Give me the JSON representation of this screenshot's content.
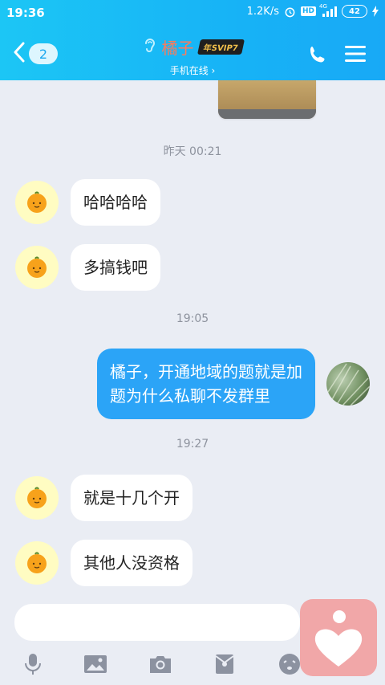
{
  "status_bar": {
    "time": "19:36",
    "network_speed": "1.2K/s",
    "hd_label": "HD",
    "signal_label": "4G",
    "battery": "42"
  },
  "header": {
    "back_badge": "2",
    "contact_name": "橘子",
    "vip_label": "年SVIP7",
    "status": "手机在线 ›"
  },
  "messages": [
    {
      "type": "timestamp",
      "text": "昨天 00:21"
    },
    {
      "type": "incoming",
      "text": "哈哈哈哈"
    },
    {
      "type": "incoming",
      "text": "多搞钱吧"
    },
    {
      "type": "timestamp",
      "text": "19:05"
    },
    {
      "type": "outgoing",
      "lines": [
        "橘子，开通地域的题就是加",
        "题为什么私聊不发群里"
      ]
    },
    {
      "type": "timestamp",
      "text": "19:27"
    },
    {
      "type": "incoming",
      "text": "就是十几个开"
    },
    {
      "type": "incoming",
      "text": "其他人没资格"
    }
  ],
  "input": {
    "placeholder": ""
  },
  "colors": {
    "header": "#18b0f6",
    "outgoing_bubble": "#2ba4f7",
    "contact_name": "#ff7a5a"
  }
}
